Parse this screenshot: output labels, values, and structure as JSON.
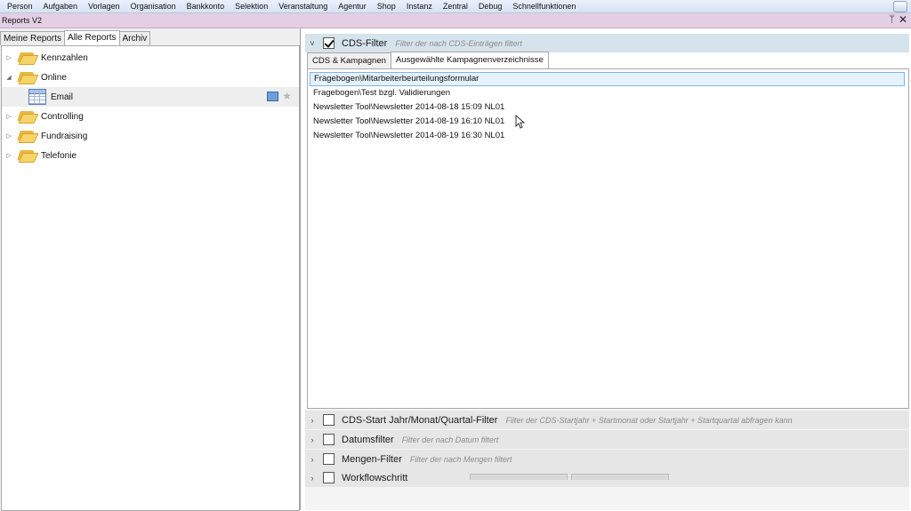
{
  "menu": [
    "Person",
    "Aufgaben",
    "Vorlagen",
    "Organisation",
    "Bankkonto",
    "Selektion",
    "Veranstaltung",
    "Agentur",
    "Shop",
    "Instanz",
    "Zentral",
    "Debug",
    "Schnellfunktionen"
  ],
  "window": {
    "title": "Reports V2",
    "pin": "ᛘ",
    "close": "✕"
  },
  "left_tabs": [
    {
      "label": "Meine Reports",
      "active": false
    },
    {
      "label": "Alle Reports",
      "active": true
    },
    {
      "label": "Archiv",
      "active": false
    }
  ],
  "tree": [
    {
      "label": "Kennzahlen",
      "expanded": false,
      "arrow": "▷"
    },
    {
      "label": "Online",
      "expanded": true,
      "arrow": "◢"
    },
    {
      "label": "Email",
      "child": true
    },
    {
      "label": "Controlling",
      "expanded": false,
      "arrow": "▷"
    },
    {
      "label": "Fundraising",
      "expanded": false,
      "arrow": "▷"
    },
    {
      "label": "Telefonie",
      "expanded": false,
      "arrow": "▷"
    }
  ],
  "cds_filter": {
    "title": "CDS-Filter",
    "desc": "Filter der nach CDS-Einträgen filtert",
    "checked": true,
    "chev": "˅",
    "tabs": [
      {
        "label": "CDS & Kampagnen",
        "active": false
      },
      {
        "label": "Ausgewählte Kampagnenverzeichnisse",
        "active": true
      }
    ],
    "items": [
      "Fragebogen\\Mitarbeiterbeurteilungsformular",
      "Fragebogen\\Test bzgl. Validierungen",
      "Newsletter Tool\\Newsletter 2014-08-18 15:09 NL01",
      "Newsletter Tool\\Newsletter 2014-08-19 16:10 NL01",
      "Newsletter Tool\\Newsletter 2014-08-19 16:30 NL01"
    ]
  },
  "filters": [
    {
      "title": "CDS-Start Jahr/Monat/Quartal-Filter",
      "desc": "Filter der CDS-Startjahr + Startmonat oder Startjahr + Startquartal abfragen kann",
      "chev": "›"
    },
    {
      "title": "Datumsfilter",
      "desc": "Filter der nach Datum filtert",
      "chev": "›"
    },
    {
      "title": "Mengen-Filter",
      "desc": "Filter der nach Mengen filtert",
      "chev": "›"
    },
    {
      "title": "Workflowschritt",
      "desc": "",
      "chev": "›"
    }
  ],
  "icons": {
    "star": "★"
  }
}
